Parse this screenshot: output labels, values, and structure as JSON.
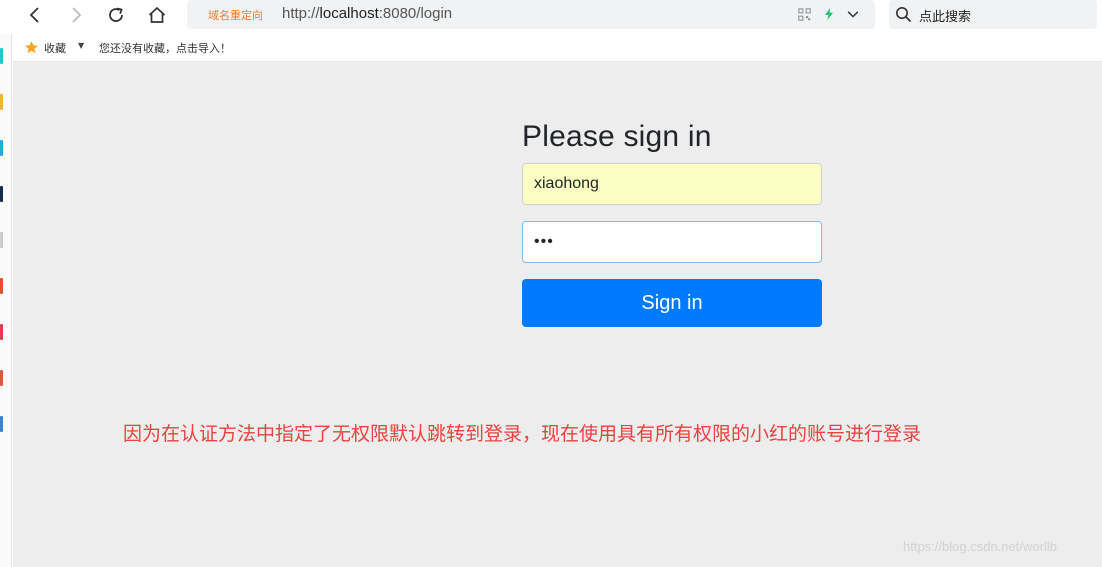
{
  "browser": {
    "redirect_tag": "域名重定向",
    "url_scheme": "http://",
    "url_host": "localhost",
    "url_rest": ":8080/login",
    "search_placeholder": "点此搜索"
  },
  "bookmarks": {
    "label": "收藏",
    "empty_message": "您还没有收藏，点击导入！"
  },
  "page": {
    "title": "Please sign in",
    "username_value": "xiaohong",
    "password_value": "•••",
    "signin_label": "Sign in"
  },
  "annotation": "因为在认证方法中指定了无权限默认跳转到登录，现在使用具有所有权限的小红的账号进行登录",
  "watermark": "https://blog.csdn.net/worllb",
  "colors": {
    "accent": "#007bff",
    "annotation": "#e8433f",
    "redirect_tag": "#f07c28",
    "autofill": "#fafec2"
  }
}
